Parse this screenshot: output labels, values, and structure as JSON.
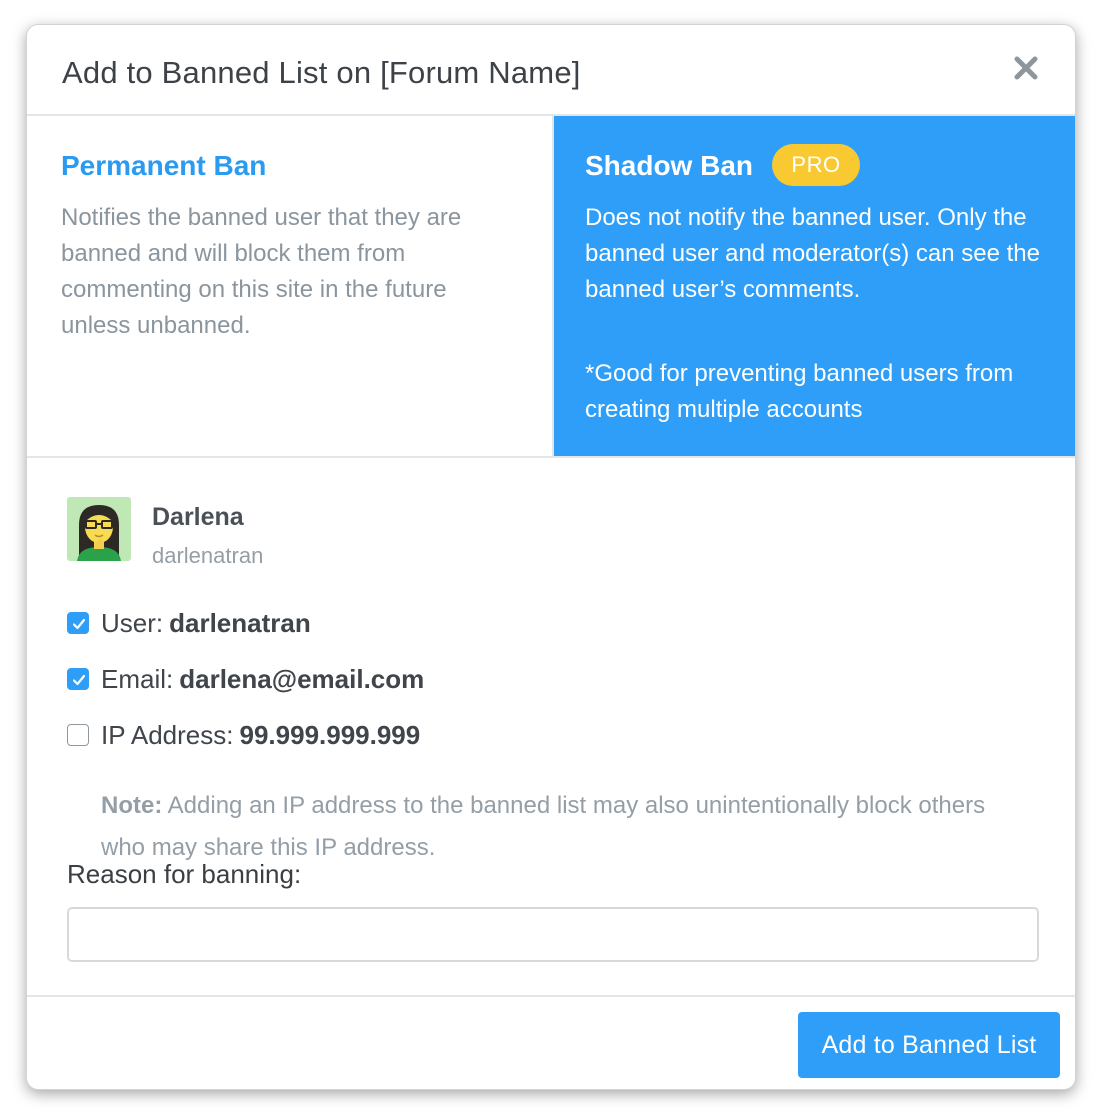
{
  "dialog": {
    "title": "Add to Banned List on [Forum Name]",
    "close_icon": "close-icon"
  },
  "ban_options": {
    "permanent": {
      "title": "Permanent Ban",
      "description": "Notifies the banned user that they are banned and will block them from commenting on this site in the future unless unbanned.",
      "selected": false
    },
    "shadow": {
      "title": "Shadow Ban",
      "badge": "PRO",
      "description": "Does not notify the banned user. Only the banned user and moderator(s) can see the banned user’s comments.",
      "note": "*Good for preventing banned users from creating multiple accounts",
      "selected": true
    }
  },
  "user": {
    "display_name": "Darlena",
    "username": "darlenatran"
  },
  "ban_targets": {
    "user": {
      "label": "User:",
      "value": "darlenatran",
      "checked": true
    },
    "email": {
      "label": "Email:",
      "value": "darlena@email.com",
      "checked": true
    },
    "ip": {
      "label": "IP Address:",
      "value": "99.999.999.999",
      "checked": false
    }
  },
  "ip_note": {
    "label": "Note:",
    "text": " Adding an IP address to the banned list may also unintentionally block others who may share this IP address."
  },
  "reason": {
    "label": "Reason for banning:",
    "value": "",
    "placeholder": ""
  },
  "footer": {
    "submit_label": "Add to Banned List"
  },
  "colors": {
    "accent": "#2e9ef8",
    "pro_badge": "#f9c932",
    "muted_text": "#8a959e"
  }
}
